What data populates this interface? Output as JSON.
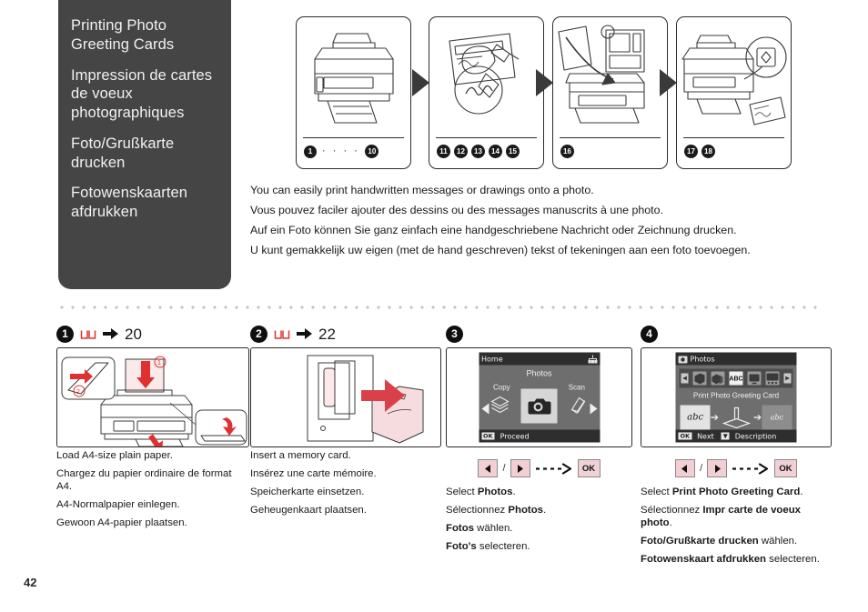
{
  "document": {
    "page_number": "42"
  },
  "title_panel": {
    "lines": [
      "Printing Photo Greeting Cards",
      "Impression de cartes de voeux photographiques",
      "Foto/Grußkarte drucken",
      "Fotowenskaarten afdrukken"
    ]
  },
  "top_illustrations": {
    "panels": [
      {
        "name": "printer-load-paper",
        "steps": [
          "1",
          "10"
        ],
        "separator": "· · · ·"
      },
      {
        "name": "handwrite-on-template",
        "steps": [
          "11",
          "12",
          "13",
          "14",
          "15"
        ]
      },
      {
        "name": "place-on-scanner-glass",
        "steps": [
          "16"
        ]
      },
      {
        "name": "press-start-to-print",
        "steps": [
          "17",
          "18"
        ]
      }
    ]
  },
  "description": {
    "lines": [
      "You can easily print handwritten messages or drawings onto a photo.",
      "Vous pouvez faciler ajouter des dessins ou des messages manuscrits à une photo.",
      "Auf ein Foto können Sie ganz einfach eine handgeschriebene Nachricht oder Zeichnung drucken.",
      "U kunt gemakkelijk uw eigen (met de hand geschreven) tekst of tekeningen aan een foto toevoegen."
    ]
  },
  "steps": [
    {
      "number": "1",
      "reference_page": "20",
      "has_book_reference": true,
      "illustration": "load-a4-paper-into-printer",
      "captions": [
        {
          "text": "Load A4-size plain paper.",
          "bold": ""
        },
        {
          "text": "Chargez du papier ordinaire de format A4.",
          "bold": ""
        },
        {
          "text": "A4-Normalpapier einlegen.",
          "bold": ""
        },
        {
          "text": "Gewoon A4-papier plaatsen.",
          "bold": ""
        }
      ]
    },
    {
      "number": "2",
      "reference_page": "22",
      "has_book_reference": true,
      "illustration": "insert-memory-card-into-slot",
      "captions": [
        {
          "text": "Insert a memory card.",
          "bold": ""
        },
        {
          "text": "Insérez une carte mémoire.",
          "bold": ""
        },
        {
          "text": "Speicherkarte einsetzen.",
          "bold": ""
        },
        {
          "text": "Geheugenkaart plaatsen.",
          "bold": ""
        }
      ]
    },
    {
      "number": "3",
      "reference_page": "",
      "has_book_reference": false,
      "illustration": "lcd-home-menu",
      "lcd": {
        "header": "Home",
        "selected_label": "Photos",
        "left_option": "Copy",
        "right_option": "Scan",
        "footer_key": "OK",
        "footer_label": "Proceed"
      },
      "buttons": [
        "left-arrow",
        "right-arrow",
        "OK"
      ],
      "ok_label": "OK",
      "captions": [
        {
          "pre": "Select ",
          "bold": "Photos",
          "post": "."
        },
        {
          "pre": "Sélectionnez ",
          "bold": "Photos",
          "post": "."
        },
        {
          "pre": "",
          "bold": "Fotos",
          "post": " wählen."
        },
        {
          "pre": "",
          "bold": "Foto's",
          "post": " selecteren."
        }
      ]
    },
    {
      "number": "4",
      "reference_page": "",
      "has_book_reference": false,
      "illustration": "lcd-photos-menu",
      "lcd": {
        "header": "Photos",
        "selected_label": "Print Photo Greeting Card",
        "icon_row": [
          "print-photos",
          "print-photos-stack",
          "ABC",
          "slideshow",
          "photo-id"
        ],
        "selected_icon": "ABC",
        "art_left": "abc",
        "art_right": "abc",
        "footer_key": "OK",
        "footer_label": "Next",
        "footer_key2": "▼",
        "footer_label2": "Description"
      },
      "buttons": [
        "left-arrow",
        "right-arrow",
        "OK"
      ],
      "ok_label": "OK",
      "captions": [
        {
          "pre": "Select ",
          "bold": "Print Photo Greeting Card",
          "post": "."
        },
        {
          "pre": "Sélectionnez ",
          "bold": "Impr carte de voeux photo",
          "post": "."
        },
        {
          "pre": "",
          "bold": "Foto/Grußkarte drucken",
          "post": " wählen."
        },
        {
          "pre": "",
          "bold": "Fotowenskaart afdrukken",
          "post": " selecteren."
        }
      ]
    }
  ],
  "colors": {
    "panel_bg": "#454545",
    "key_bg": "#f2cfd3",
    "accent_red": "#e03a3a",
    "lcd_bg": "#6e6e6e",
    "lcd_bar": "#2e2e2e"
  }
}
